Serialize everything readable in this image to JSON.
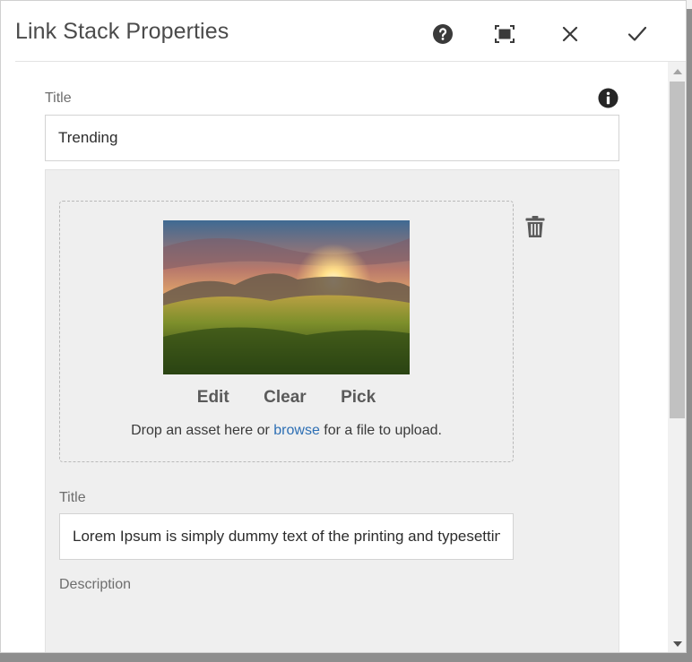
{
  "dialog": {
    "title": "Link Stack Properties",
    "icons": {
      "help": "help-circle-icon",
      "fullscreen": "fullscreen-icon",
      "close": "close-icon",
      "done": "checkmark-icon"
    }
  },
  "form": {
    "title_label": "Title",
    "title_value": "Trending",
    "info_icon": "info-circle-icon",
    "item": {
      "image_alt": "sunset-over-grassy-hills-thumbnail",
      "actions": {
        "edit": "Edit",
        "clear": "Clear",
        "pick": "Pick"
      },
      "drop_text_before": "Drop an asset here or ",
      "drop_link": "browse",
      "drop_text_after": " for a file to upload.",
      "delete_icon": "trash-icon",
      "title_label": "Title",
      "title_value": "Lorem Ipsum is simply dummy text of the printing and typesetting",
      "description_label": "Description"
    }
  },
  "colors": {
    "accent_link": "#2d6fb4",
    "panel_bg": "#efefef",
    "scroll_thumb": "#c1c1c1"
  }
}
